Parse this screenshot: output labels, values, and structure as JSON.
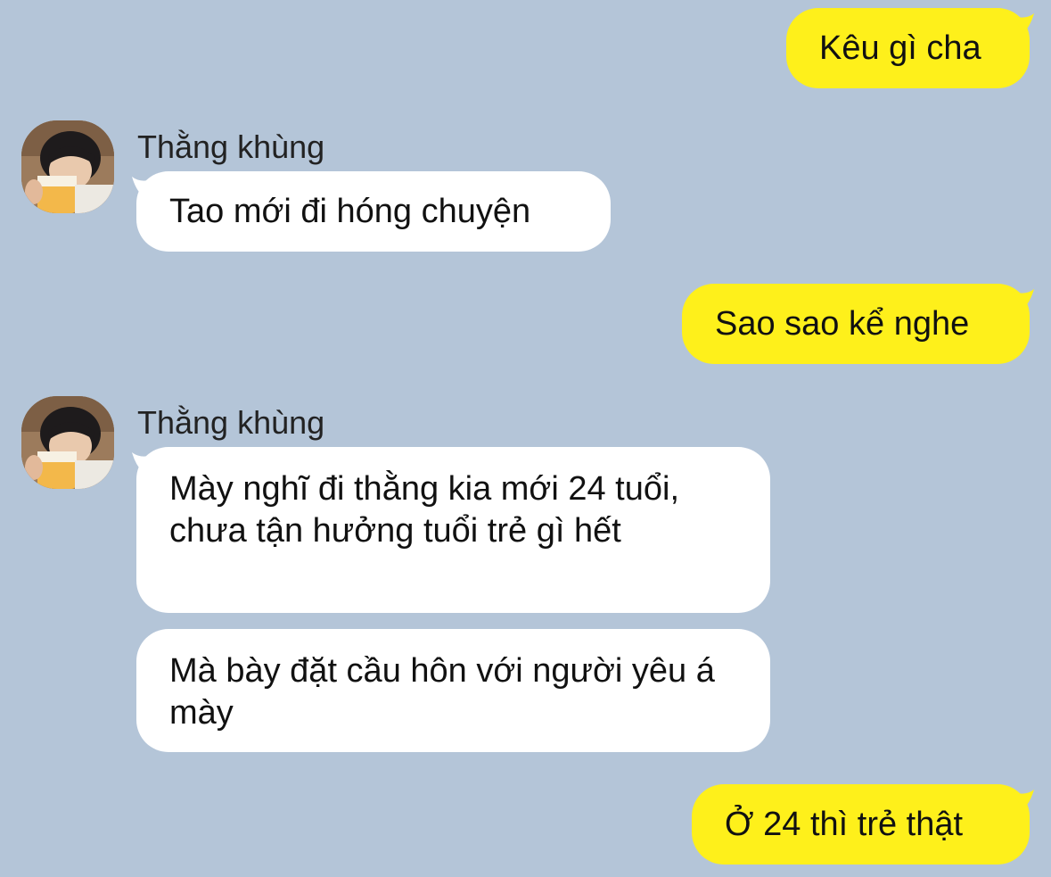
{
  "conversation": {
    "contact_name": "Thằng khùng",
    "messages": [
      {
        "direction": "outgoing",
        "text": "Kêu gì cha"
      },
      {
        "direction": "incoming",
        "sender": "Thằng khùng",
        "text": "Tao mới đi hóng chuyện"
      },
      {
        "direction": "outgoing",
        "text": "Sao sao kể nghe"
      },
      {
        "direction": "incoming",
        "sender": "Thằng khùng",
        "text": "Mày nghĩ đi thằng kia mới 24 tuổi, chưa tận hưởng tuổi trẻ gì hết"
      },
      {
        "direction": "incoming",
        "sender": "Thằng khùng",
        "text": "Mà bày đặt cầu hôn với người yêu á mày"
      },
      {
        "direction": "outgoing",
        "text": "Ở 24 thì trẻ thật"
      }
    ]
  },
  "colors": {
    "background": "#b4c5d8",
    "outgoing_bubble": "#fef01b",
    "incoming_bubble": "#ffffff"
  },
  "icons": {
    "avatar": "contact-avatar-photo"
  }
}
